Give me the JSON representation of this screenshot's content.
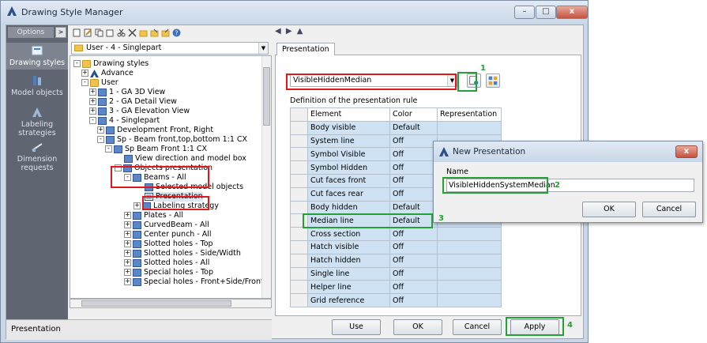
{
  "window": {
    "title": "Drawing Style Manager"
  },
  "leftnav": {
    "options_label": "Options",
    "options_btn": ">",
    "items": [
      {
        "label": "Drawing styles",
        "icon": "drawing-styles-icon"
      },
      {
        "label": "Model objects",
        "icon": "model-objects-icon"
      },
      {
        "label": "Labeling strategies",
        "icon": "labeling-icon"
      },
      {
        "label": "Dimension requests",
        "icon": "dimension-icon"
      }
    ]
  },
  "tree": {
    "combo_value": "User - 4 - Singlepart",
    "rows": [
      "Drawing styles",
      "Advance",
      "User",
      "1 - GA 3D View",
      "2 - GA Detail View",
      "3 - GA Elevation View",
      "4 - Singlepart",
      "Development Front, Right",
      "Sp - Beam front,top,bottom 1:1 CX",
      "Sp Beam Front 1:1 CX",
      "View direction and model box",
      "Objects presentation",
      "Beams - All",
      "Selected model objects",
      "Presentation",
      "Labeling strategy",
      "Plates - All",
      "CurvedBeam - All",
      "Center punch - All",
      "Slotted holes - Top",
      "Slotted holes - Side/Width",
      "Slotted holes - All",
      "Special holes - Top",
      "Special holes - Front+Side/Front"
    ]
  },
  "status": {
    "text": "Presentation"
  },
  "right": {
    "tab": "Presentation",
    "combo_value": "VisibleHiddenMedian",
    "rule_label": "Definition of the presentation rule",
    "columns": [
      "Element",
      "Color",
      "Representation"
    ],
    "rows": [
      {
        "element": "Body visible",
        "color": "Default"
      },
      {
        "element": "System line",
        "color": "Off"
      },
      {
        "element": "Symbol Visible",
        "color": "Off"
      },
      {
        "element": "Symbol Hidden",
        "color": "Off"
      },
      {
        "element": "Cut faces front",
        "color": "Off"
      },
      {
        "element": "Cut faces rear",
        "color": "Off"
      },
      {
        "element": "Body hidden",
        "color": "Default"
      },
      {
        "element": "Median line",
        "color": "Default"
      },
      {
        "element": "Cross section",
        "color": "Off"
      },
      {
        "element": "Hatch visible",
        "color": "Off"
      },
      {
        "element": "Hatch hidden",
        "color": "Off"
      },
      {
        "element": "Single line",
        "color": "Off"
      },
      {
        "element": "Helper line",
        "color": "Off"
      },
      {
        "element": "Grid reference",
        "color": "Off"
      }
    ]
  },
  "buttons": {
    "use": "Use",
    "ok": "OK",
    "cancel": "Cancel",
    "apply": "Apply"
  },
  "dialog": {
    "title": "New Presentation",
    "name_label": "Name",
    "name_value": "VisibleHiddenSystemMedian",
    "ok": "OK",
    "cancel": "Cancel",
    "close": "x"
  },
  "annotations": {
    "a1": "1",
    "a2": "2",
    "a3": "3",
    "a4": "4"
  },
  "colors": {
    "highlight_red": "#e0171b",
    "highlight_green": "#25a036",
    "accent": "#2f5794"
  }
}
